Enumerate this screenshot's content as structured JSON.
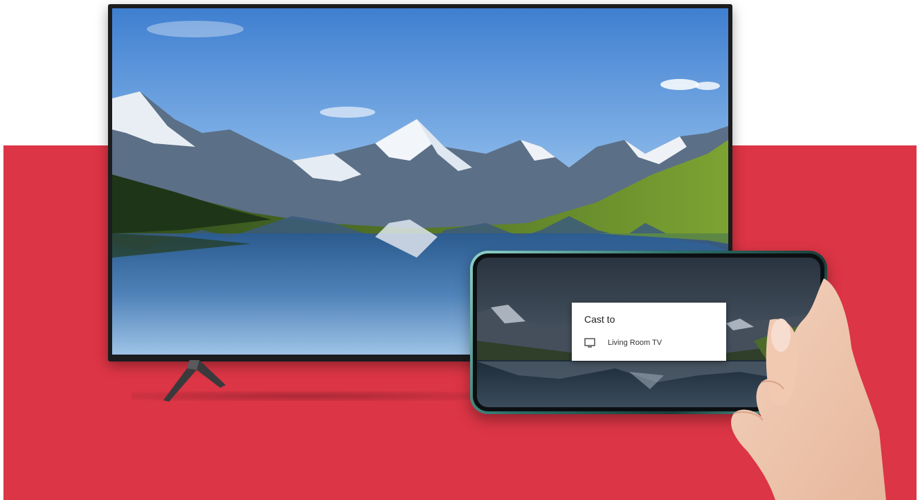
{
  "cast_dialog": {
    "title": "Cast to",
    "devices": [
      {
        "name": "Living Room TV",
        "icon": "tv-icon"
      }
    ]
  },
  "colors": {
    "accent_band": "#dc3545",
    "background": "#ffffff",
    "dialog_bg": "#ffffff"
  }
}
